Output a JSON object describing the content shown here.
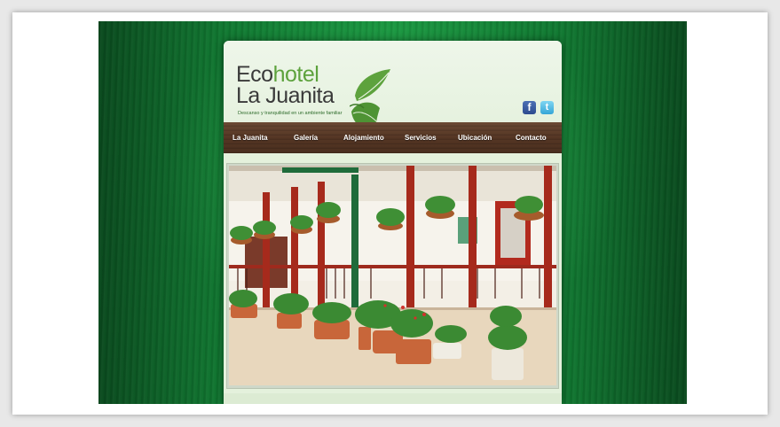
{
  "logo": {
    "eco": "Eco",
    "hotel": "hotel",
    "name_line2": "La Juanita",
    "tagline": "Descanso y tranquilidad en un ambiente familiar"
  },
  "social": {
    "facebook_glyph": "f",
    "twitter_glyph": "t",
    "facebook_icon": "facebook-icon",
    "twitter_icon": "twitter-icon"
  },
  "nav": {
    "items": [
      {
        "label": "La Juanita"
      },
      {
        "label": "Galería"
      },
      {
        "label": "Alojamiento"
      },
      {
        "label": "Servicios"
      },
      {
        "label": "Ubicación"
      },
      {
        "label": "Contacto"
      }
    ]
  },
  "colors": {
    "brand_green": "#5da23d",
    "nav_wood": "#553624",
    "background_green": "#18953f"
  }
}
